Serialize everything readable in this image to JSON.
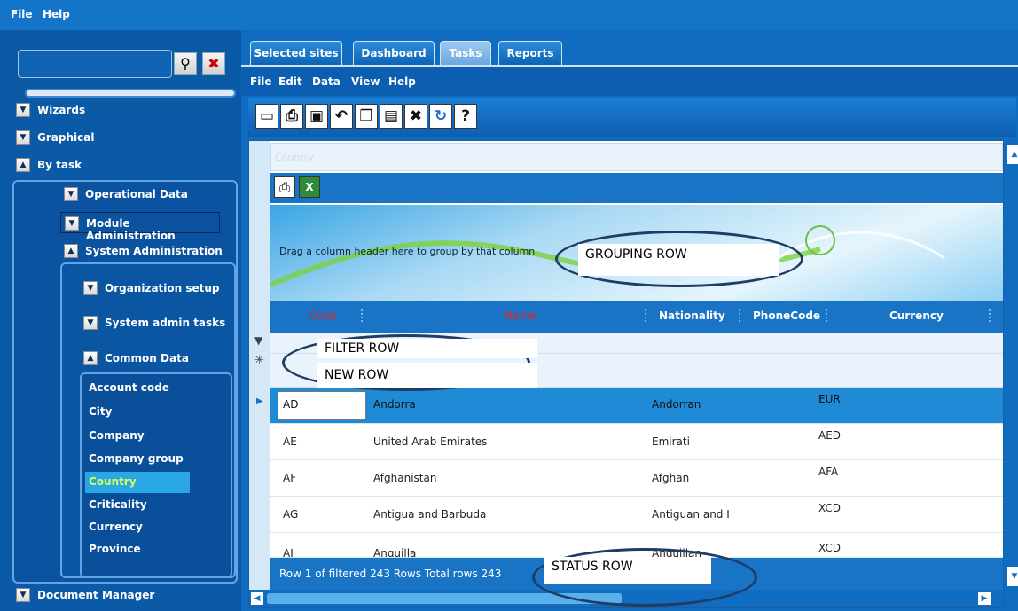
{
  "top_menu": {
    "file": "File",
    "help": "Help"
  },
  "left_nav": {
    "wizards": "Wizards",
    "graphical": "Graphical",
    "by_task": "By task",
    "operational_data": "Operational Data",
    "module_administration": "Module Administration",
    "system_administration": "System Administration",
    "organization_setup": "Organization setup",
    "system_admin_tasks": "System admin tasks",
    "common_data": "Common Data",
    "common_items": [
      "Account code",
      "City",
      "Company",
      "Company group",
      "Country",
      "Criticality",
      "Currency",
      "Province"
    ],
    "selected_item": "Country",
    "document_manager": "Document Manager"
  },
  "tabs": [
    "Selected sites",
    "Dashboard",
    "Tasks",
    "Reports"
  ],
  "active_tab": "Tasks",
  "inner_menu": {
    "file": "File",
    "edit": "Edit",
    "data": "Data",
    "view": "View",
    "help": "Help"
  },
  "toolbar_icons": [
    "new-document-icon",
    "print-icon",
    "save-icon",
    "undo-icon",
    "copy-icon",
    "paste-icon",
    "delete-icon",
    "refresh-icon",
    "help-icon"
  ],
  "grid": {
    "title": "Country",
    "group_hint": "Drag a column header here to group by that column",
    "columns": [
      "Code",
      "Name",
      "Nationality",
      "PhoneCode",
      "Currency"
    ],
    "rows": [
      {
        "code": "AD",
        "name": "Andorra",
        "nationality": "Andorran",
        "currency": "EUR"
      },
      {
        "code": "AE",
        "name": "United Arab Emirates",
        "nationality": "Emirati",
        "currency": "AED"
      },
      {
        "code": "AF",
        "name": "Afghanistan",
        "nationality": "Afghan",
        "currency": "AFA"
      },
      {
        "code": "AG",
        "name": "Antigua and Barbuda",
        "nationality": "Antiguan and I",
        "currency": "XCD"
      },
      {
        "code": "AI",
        "name": "Anguilla",
        "nationality": "Anguillan",
        "currency": "XCD"
      }
    ],
    "status": "Row 1 of filtered 243 Rows  Total rows 243"
  },
  "annotations": {
    "grouping_row": "GROUPING ROW",
    "filter_row": "FILTER ROW",
    "new_row": "NEW ROW",
    "status_row": "STATUS ROW"
  },
  "colors": {
    "background": "#0f6fc1",
    "selected_item": "#29a6e4",
    "selected_text": "#d4ff5a",
    "current_row": "#1f8ad6",
    "header_red": "#d81b1b"
  }
}
